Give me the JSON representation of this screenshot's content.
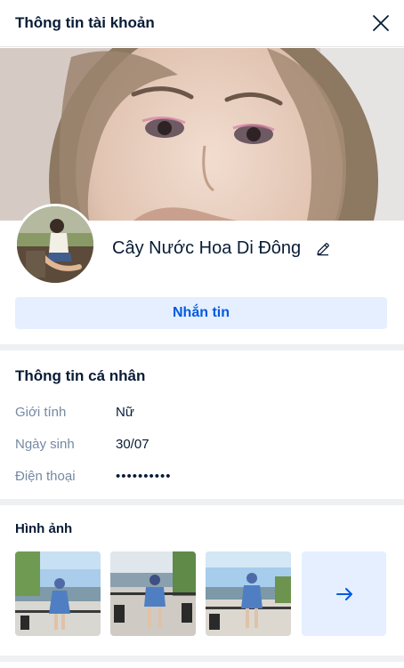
{
  "header": {
    "title": "Thông tin tài khoản"
  },
  "profile": {
    "name": "Cây Nước Hoa Di Đông",
    "message_button": "Nhắn tin"
  },
  "personal_info": {
    "title": "Thông tin cá nhân",
    "rows": [
      {
        "label": "Giới tính",
        "value": "Nữ"
      },
      {
        "label": "Ngày sinh",
        "value": "30/07"
      },
      {
        "label": "Điện thoại",
        "value": "••••••••••"
      }
    ]
  },
  "photos": {
    "title": "Hình ảnh"
  },
  "colors": {
    "accent": "#005ae0",
    "accent_bg": "#e5efff",
    "text": "#081c36",
    "muted": "#7589a3",
    "divider": "#eef0f1"
  },
  "icons": [
    "close-icon",
    "edit-pencil-icon",
    "arrow-right-icon"
  ]
}
